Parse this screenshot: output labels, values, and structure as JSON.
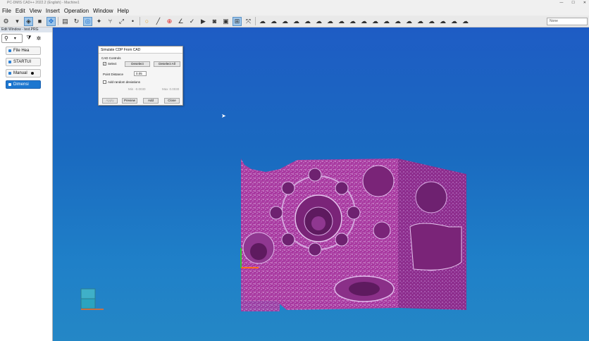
{
  "window": {
    "title": "PC-DMIS CAD++ 2022.2 (English) - Machine1",
    "controls": [
      "—",
      "☐",
      "✕"
    ]
  },
  "menu": {
    "items": [
      "File",
      "Edit",
      "View",
      "Insert",
      "Operation",
      "Window",
      "Help"
    ]
  },
  "toolbar": {
    "combo_value": "None"
  },
  "edit_window": {
    "title": "Edit Window - test.PRG",
    "commands": [
      {
        "label": "File Hea",
        "selected": false
      },
      {
        "label": "STARTUI",
        "selected": false
      },
      {
        "label": "Manual",
        "selected": false
      },
      {
        "label": "Dimensi",
        "selected": true
      }
    ]
  },
  "dialog": {
    "title": "Simulate CDP From CAD",
    "group_label": "CAD Controls",
    "select_label": "Select",
    "deselect_label": "Deselect",
    "deselect_all_label": "Deselect All",
    "point_distance_label": "Point Distance",
    "point_distance_value": "0.05",
    "random_deviations_label": "Add random deviations",
    "min_label": "Min",
    "min_value": "-0.0030",
    "max_label": "Max",
    "max_value": "0.0030",
    "apply_label": "Apply",
    "preview_label": "Preview",
    "add_label": "Add",
    "close_label": "Close"
  },
  "colors": {
    "viewport_top": "#1e5cc4",
    "viewport_bottom": "#2487c6",
    "point_cloud": "#b63fb8",
    "selected_command": "#1c77d0"
  }
}
